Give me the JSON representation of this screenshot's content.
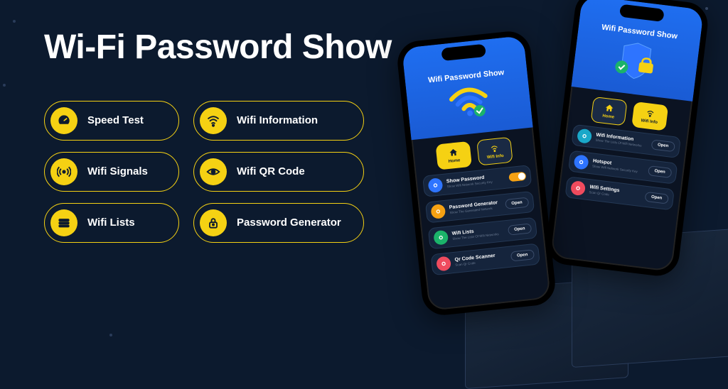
{
  "title": "Wi-Fi Password Show",
  "features": [
    {
      "label": "Speed Test",
      "icon": "gauge"
    },
    {
      "label": "Wifi Information",
      "icon": "wifi"
    },
    {
      "label": "Wifi Signals",
      "icon": "signal"
    },
    {
      "label": "Wifi QR Code",
      "icon": "eye"
    },
    {
      "label": "Wifi Lists",
      "icon": "list"
    },
    {
      "label": "Password Generator",
      "icon": "lock"
    }
  ],
  "phoneA": {
    "header": "Wifi Password Show",
    "tabs": [
      {
        "label": "Home",
        "active": true
      },
      {
        "label": "Wifi Info",
        "active": false
      }
    ],
    "rows": [
      {
        "title": "Show Password",
        "sub": "Show Wifi Network Security Key",
        "color": "c-blue",
        "toggle": true
      },
      {
        "title": "Password Generator",
        "sub": "Show The Generated Network",
        "color": "c-orange",
        "action": "Open"
      },
      {
        "title": "Wifi Lists",
        "sub": "Show The Lists Of Wifi Networks",
        "color": "c-green",
        "action": "Open"
      },
      {
        "title": "Qr Code Scanner",
        "sub": "Scan Qr Code",
        "color": "c-red",
        "action": "Open"
      }
    ]
  },
  "phoneB": {
    "header": "Wifi Password Show",
    "tabs": [
      {
        "label": "Home",
        "active": false
      },
      {
        "label": "Wifi Info",
        "active": true
      }
    ],
    "rows": [
      {
        "title": "Wifi Information",
        "sub": "Show The Lists Of Wifi Networks",
        "color": "c-teal",
        "action": "Open"
      },
      {
        "title": "Hotspot",
        "sub": "Show Wifi Network Security Key",
        "color": "c-blue",
        "action": "Open"
      },
      {
        "title": "Wifi Settings",
        "sub": "Scan Qr Code",
        "color": "c-red",
        "action": "Open"
      }
    ]
  }
}
